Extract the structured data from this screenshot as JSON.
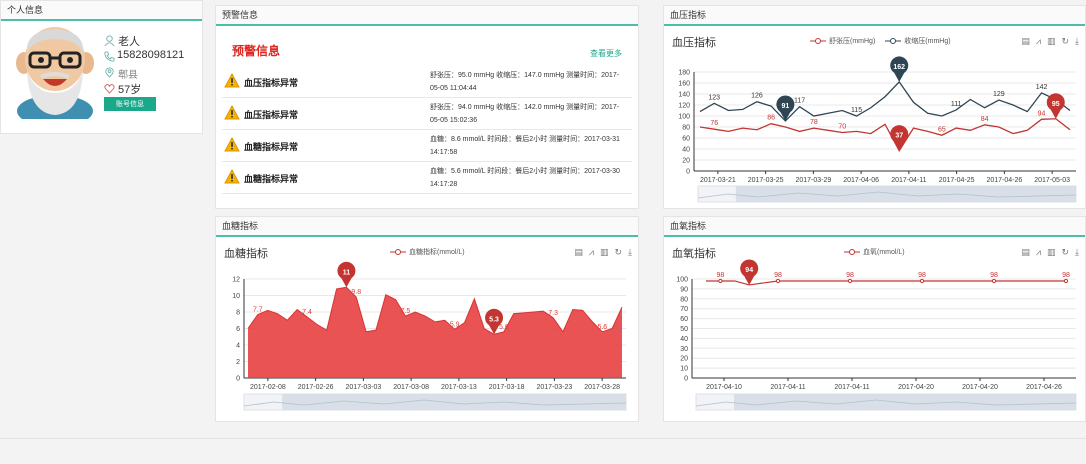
{
  "profile": {
    "title": "个人信息",
    "name": "老人",
    "phone": "15828098121",
    "location": "郫县",
    "age": "57岁",
    "account_button": "账号信息"
  },
  "warnings": {
    "title": "预警信息",
    "heading": "预警信息",
    "more": "查看更多",
    "items": [
      {
        "title": "血压指标异常",
        "detail": "舒张压：95.0 mmHg 收缩压：147.0 mmHg 测量时间：2017-05-05 11:04:44"
      },
      {
        "title": "血压指标异常",
        "detail": "舒张压：94.0 mmHg 收缩压：142.0 mmHg 测量时间：2017-05-05 15:02:36"
      },
      {
        "title": "血糖指标异常",
        "detail": "血糖：8.6 mmol/L 时间段：餐后2小时 测量时间：2017-03-31 14:17:58"
      },
      {
        "title": "血糖指标异常",
        "detail": "血糖：5.6 mmol/L 时间段：餐后2小时 测量时间：2017-03-30 14:17:28"
      }
    ]
  },
  "bp_panel": {
    "title": "血压指标",
    "chart_title": "血压指标",
    "colors": {
      "diastolic": "#c23531",
      "systolic": "#2f4554"
    }
  },
  "sugar_panel": {
    "title": "血糖指标",
    "chart_title": "血糖指标",
    "color": "#e84040"
  },
  "oxygen_panel": {
    "title": "血氧指标",
    "chart_title": "血氧指标",
    "color": "#c23531"
  },
  "chart_data": [
    {
      "type": "line",
      "title": "血压指标",
      "ylim": [
        0,
        180
      ],
      "yticks": [
        0,
        20,
        40,
        60,
        80,
        100,
        120,
        140,
        160,
        180
      ],
      "x_ticks": [
        "2017-03-21",
        "2017-03-25",
        "2017-03-29",
        "2017-04-06",
        "2017-04-11",
        "2017-04-25",
        "2017-04-26",
        "2017-05-03"
      ],
      "series": [
        {
          "name": "舒张压(mmHg)",
          "values": [
            80,
            76,
            72,
            78,
            75,
            86,
            80,
            72,
            78,
            74,
            70,
            72,
            68,
            85,
            37,
            78,
            72,
            65,
            78,
            74,
            84,
            80,
            68,
            74,
            94,
            95,
            75
          ]
        },
        {
          "name": "收缩压(mmHg)",
          "values": [
            108,
            123,
            110,
            112,
            126,
            118,
            91,
            117,
            100,
            105,
            110,
            100,
            115,
            135,
            162,
            125,
            105,
            100,
            111,
            130,
            115,
            129,
            120,
            108,
            142,
            130,
            110
          ]
        }
      ],
      "labels": {
        "diastolic": [
          {
            "i": 1,
            "v": "76"
          },
          {
            "i": 5,
            "v": "86"
          },
          {
            "i": 8,
            "v": "78"
          },
          {
            "i": 10,
            "v": "70"
          },
          {
            "i": 17,
            "v": "65"
          },
          {
            "i": 20,
            "v": "84"
          },
          {
            "i": 24,
            "v": "94"
          }
        ],
        "systolic": [
          {
            "i": 1,
            "v": "123"
          },
          {
            "i": 4,
            "v": "126"
          },
          {
            "i": 7,
            "v": "117"
          },
          {
            "i": 11,
            "v": "115"
          },
          {
            "i": 18,
            "v": "111"
          },
          {
            "i": 21,
            "v": "129"
          },
          {
            "i": 24,
            "v": "142"
          }
        ]
      },
      "pins": [
        {
          "series": 1,
          "i": 6,
          "v": "91"
        },
        {
          "series": 1,
          "i": 14,
          "v": "162"
        },
        {
          "series": 0,
          "i": 14,
          "v": "37"
        },
        {
          "series": 0,
          "i": 25,
          "v": "95"
        }
      ]
    },
    {
      "type": "area",
      "title": "血糖指标",
      "ylim": [
        0,
        12
      ],
      "yticks": [
        0,
        2,
        4,
        6,
        8,
        10,
        12
      ],
      "x_ticks": [
        "2017-02-08",
        "2017-02-26",
        "2017-03-03",
        "2017-03-08",
        "2017-03-13",
        "2017-03-18",
        "2017-03-23",
        "2017-03-28"
      ],
      "series": [
        {
          "name": "血糖指标(mmol/L)",
          "values": [
            6,
            7.7,
            8.2,
            7.8,
            7,
            8.3,
            7.4,
            6.5,
            5.8,
            10.8,
            11,
            9.8,
            5.6,
            5.8,
            10.1,
            9.5,
            7.5,
            8,
            7.5,
            6.8,
            7,
            5.9,
            6.7,
            9.6,
            6,
            5.3,
            5.6,
            7.8,
            7.9,
            8,
            8.1,
            7.3,
            5.6,
            8.3,
            8.2,
            6.8,
            5.6,
            6,
            8.6
          ]
        }
      ],
      "labels": [
        {
          "i": 1,
          "v": "7.7"
        },
        {
          "i": 6,
          "v": "7.4"
        },
        {
          "i": 11,
          "v": "9.8"
        },
        {
          "i": 16,
          "v": "7.5"
        },
        {
          "i": 21,
          "v": "5.9"
        },
        {
          "i": 26,
          "v": "5.6"
        },
        {
          "i": 31,
          "v": "7.3"
        },
        {
          "i": 36,
          "v": "5.6"
        }
      ],
      "pins": [
        {
          "i": 10,
          "v": "11"
        },
        {
          "i": 25,
          "v": "5.3"
        }
      ]
    },
    {
      "type": "line",
      "title": "血氧指标",
      "ylim": [
        0,
        100
      ],
      "yticks": [
        0,
        10,
        20,
        30,
        40,
        50,
        60,
        70,
        80,
        90,
        100
      ],
      "x_ticks": [
        "2017-04-10",
        "2017-04-11",
        "2017-04-11",
        "2017-04-20",
        "2017-04-20",
        "2017-04-26"
      ],
      "series": [
        {
          "name": "血氧(mmol/L)",
          "values": [
            98,
            98,
            98,
            94,
            96,
            98,
            98,
            98,
            98,
            98,
            98,
            98,
            98,
            98,
            98,
            98,
            98,
            98,
            98,
            98,
            98,
            98,
            98,
            98,
            98,
            98
          ]
        }
      ],
      "labels": [
        {
          "i": 1,
          "v": "98"
        },
        {
          "i": 5,
          "v": "98"
        },
        {
          "i": 10,
          "v": "98"
        },
        {
          "i": 15,
          "v": "98"
        },
        {
          "i": 20,
          "v": "98"
        },
        {
          "i": 25,
          "v": "98"
        }
      ],
      "pins": [
        {
          "i": 3,
          "v": "94"
        }
      ]
    }
  ]
}
